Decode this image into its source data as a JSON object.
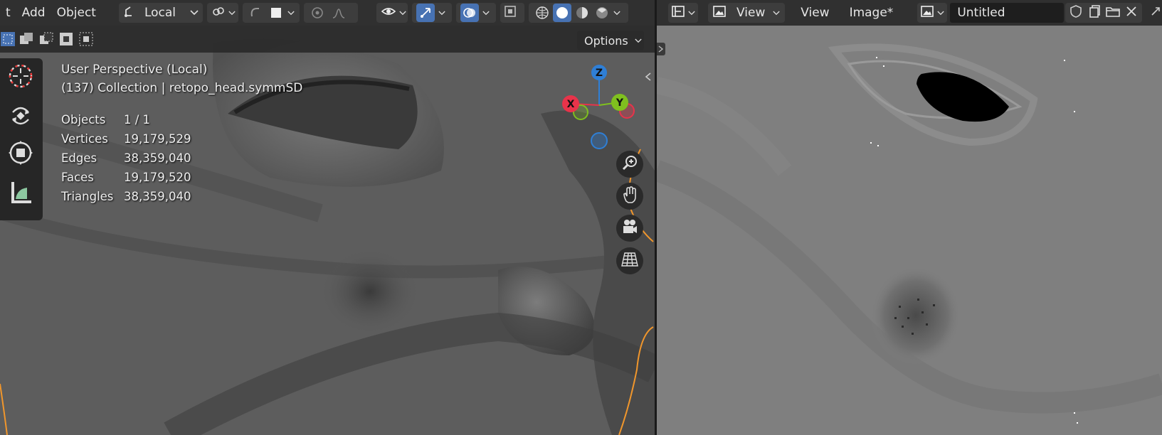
{
  "viewport_3d": {
    "menu": [
      "t",
      "Add",
      "Object"
    ],
    "transform_orientation": "Local",
    "options_label": "Options",
    "view_name": "User Perspective (Local)",
    "collection_info": "(137) Collection | retopo_head.symmSD",
    "stats": [
      {
        "label": "Objects",
        "value": "1 / 1"
      },
      {
        "label": "Vertices",
        "value": "19,179,529"
      },
      {
        "label": "Edges",
        "value": "38,359,040"
      },
      {
        "label": "Faces",
        "value": "19,179,520"
      },
      {
        "label": "Triangles",
        "value": "38,359,040"
      }
    ],
    "gizmo": {
      "x": "X",
      "y": "Y",
      "z": "Z"
    },
    "colors": {
      "x_axis": "#e8334a",
      "y_axis": "#7fbf1f",
      "z_axis": "#2f7fd6",
      "active": "#4772b3",
      "object_outline": "#f0962c"
    }
  },
  "image_editor": {
    "view_menu": "View",
    "menus": [
      "View",
      "Image*"
    ],
    "image_name": "Untitled"
  },
  "icons": [
    "cursor-icon",
    "rotate-icon",
    "move-icon",
    "measure-icon",
    "zoom-icon",
    "hand-icon",
    "camera-icon",
    "grid-icon",
    "shield-icon",
    "new-image-icon",
    "folder-icon",
    "close-icon"
  ]
}
